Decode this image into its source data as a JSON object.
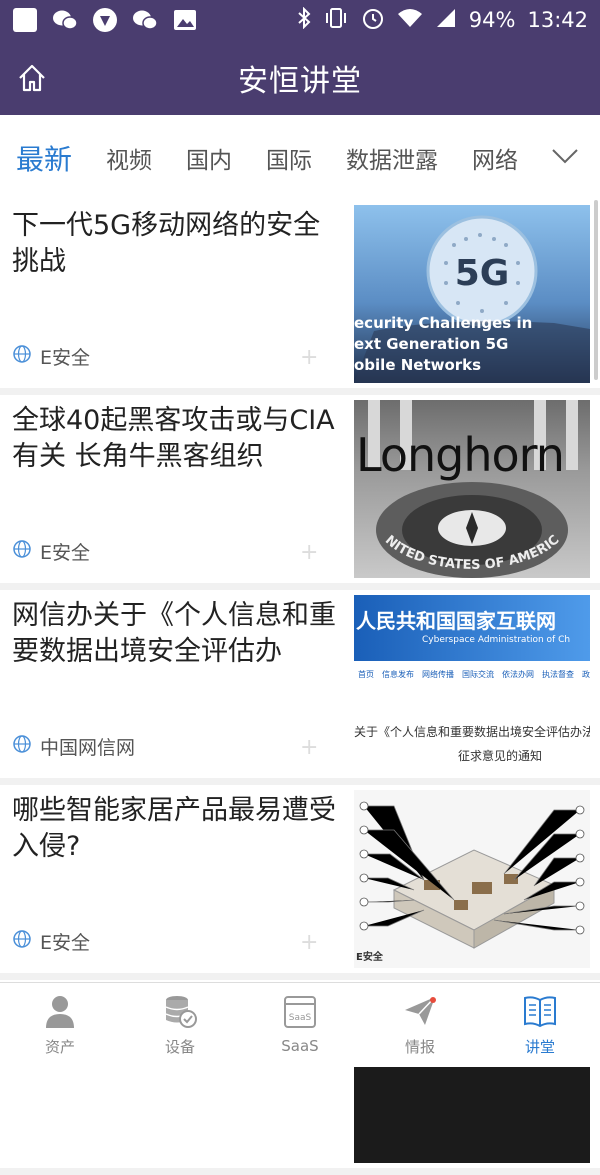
{
  "status_bar": {
    "battery": "94%",
    "time": "13:42"
  },
  "header": {
    "title": "安恒讲堂"
  },
  "tabs": [
    {
      "label": "最新",
      "active": true
    },
    {
      "label": "视频"
    },
    {
      "label": "国内"
    },
    {
      "label": "国际"
    },
    {
      "label": "数据泄露"
    },
    {
      "label": "网络"
    }
  ],
  "articles": [
    {
      "title": "下一代5G移动网络的安全挑战",
      "source": "E安全",
      "image": {
        "caption_lines": [
          "ecurity Challenges in",
          "ext Generation 5G",
          "obile Networks"
        ],
        "badge": "5G"
      }
    },
    {
      "title": "全球40起黑客攻击或与CIA有关 长角牛黑客组织",
      "source": "E安全",
      "image": {
        "overlay": "Longhorn",
        "seal_text": "UNITED STATES OF AMERICA"
      }
    },
    {
      "title": "网信办关于《个人信息和重要数据出境安全评估办",
      "source": "中国网信网",
      "image": {
        "headline": "人民共和国国家互联网",
        "subheadline": "Cyberspace Administration of Ch",
        "nav": [
          "首页",
          "信息发布",
          "网络传播",
          "国际交流",
          "依法办网",
          "执法督查",
          "政策法规"
        ],
        "notice": "关于《个人信息和重要数据出境安全评估办法",
        "notice2": "征求意见的通知"
      }
    },
    {
      "title": "哪些智能家居产品最易遭受入侵?",
      "source": "E安全",
      "image": {
        "badge": "E安全"
      }
    }
  ],
  "bottom_nav": [
    {
      "label": "资产",
      "icon": "user-icon"
    },
    {
      "label": "设备",
      "icon": "database-icon"
    },
    {
      "label": "SaaS",
      "icon": "saas-icon"
    },
    {
      "label": "情报",
      "icon": "paper-plane-icon",
      "badge_dot": true
    },
    {
      "label": "讲堂",
      "icon": "book-icon",
      "active": true
    }
  ],
  "colors": {
    "header": "#4a3d6f",
    "accent": "#2a7bd0"
  }
}
